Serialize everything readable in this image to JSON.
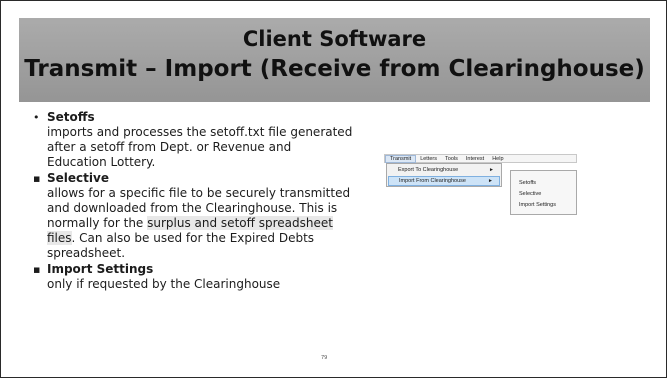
{
  "title": {
    "line1": "Client Software",
    "line2": "Transmit – Import (Receive from Clearinghouse)"
  },
  "bullets": [
    {
      "marker": "•",
      "heading": "Setoffs",
      "text": "imports and processes the setoff.txt file generated after a setoff from Dept. or Revenue and Education Lottery."
    },
    {
      "marker": "▪",
      "heading": "Selective",
      "text_before": "allows for a specific file to be securely transmitted and downloaded from the Clearinghouse. This is normally for the ",
      "text_highlight": "surplus and setoff spreadsheet files",
      "text_after": ". Can also be used for the Expired Debts spreadsheet."
    },
    {
      "marker": "▪",
      "heading": "Import Settings",
      "text": "only if requested by the Clearinghouse"
    }
  ],
  "page_number": "79",
  "menu_screenshot": {
    "menubar": [
      "Transmit",
      "Letters",
      "Tools",
      "Interest",
      "Help"
    ],
    "active_menu": "Transmit",
    "dropdown": [
      {
        "label": "Export To Clearinghouse",
        "arrow": "►"
      },
      {
        "label": "Import From Clearinghouse",
        "arrow": "►"
      }
    ],
    "submenu": [
      "Setoffs",
      "Selective",
      "Import Settings"
    ]
  }
}
